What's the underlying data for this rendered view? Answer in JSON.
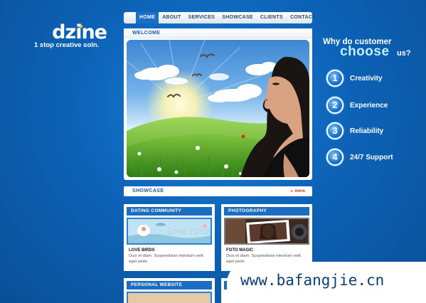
{
  "logo": {
    "word": "dzine",
    "tagline": "1 stop creative soln."
  },
  "nav": {
    "items": [
      "HOME",
      "ABOUT",
      "SERVICES",
      "SHOWCASE",
      "CLIENTS",
      "CONTACT"
    ],
    "active": "HOME"
  },
  "welcome": {
    "title": "WELCOME"
  },
  "showcase": {
    "title": "SHOWCASE",
    "more": "more"
  },
  "cards": [
    {
      "head": "DATING COMMUNITY",
      "image_caption": "Love Birds",
      "title": "LOVE BIRDS",
      "text": "Duis et diam. Suspendisse interdum velit eget pede."
    },
    {
      "head": "PHOTOGRAPHY",
      "title": "FOTO MAGIC",
      "text": "Duis et diam. Suspendisse interdum velit eget pede."
    },
    {
      "head": "PERSONAL WEBSITE"
    }
  ],
  "why": {
    "question": "Why do customer",
    "emphasis": "choose",
    "suffix": "us?",
    "reasons": [
      {
        "num": "1",
        "label": "Creativity"
      },
      {
        "num": "2",
        "label": "Experience"
      },
      {
        "num": "3",
        "label": "Reliability"
      },
      {
        "num": "4",
        "label": "24/7 Support"
      }
    ]
  },
  "watermark": "www.bafangjie.cn",
  "colors": {
    "accent": "#1a6fc6",
    "background": "#0d63b8",
    "more": "#c0392b"
  }
}
